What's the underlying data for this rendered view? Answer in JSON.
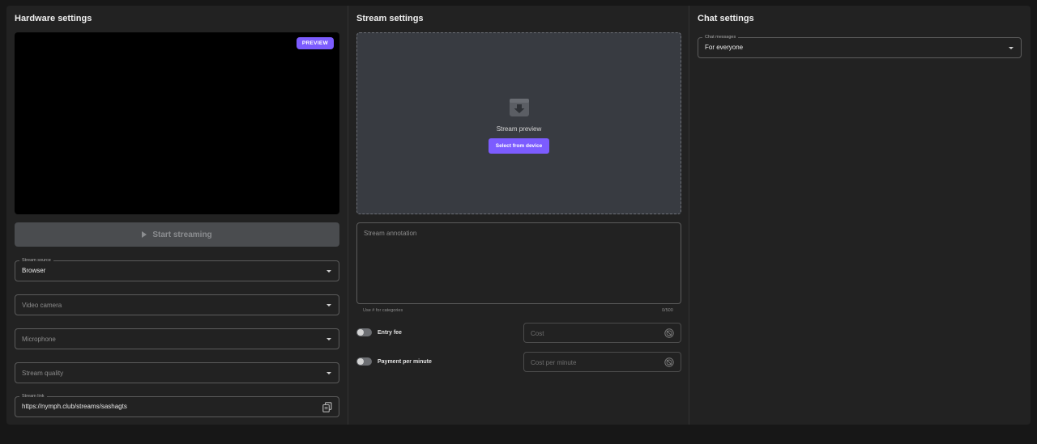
{
  "hardware": {
    "title": "Hardware settings",
    "preview_badge": "PREVIEW",
    "start_button": "Start streaming",
    "stream_source": {
      "label": "Stream source",
      "value": "Browser"
    },
    "video_camera": {
      "placeholder": "Video camera"
    },
    "microphone": {
      "placeholder": "Microphone"
    },
    "stream_quality": {
      "placeholder": "Stream quality"
    },
    "stream_link": {
      "label": "Stream link",
      "value": "https://nymph.club/streams/sashagts"
    }
  },
  "stream": {
    "title": "Stream settings",
    "preview_label": "Stream preview",
    "select_button": "Select from device",
    "annotation_placeholder": "Stream annotation",
    "annotation_hint": "Use # for categories",
    "annotation_counter": "0/500",
    "entry_fee": {
      "label": "Entry fee",
      "cost_placeholder": "Cost"
    },
    "payment_per_minute": {
      "label": "Payment per minute",
      "cost_placeholder": "Cost per minute"
    }
  },
  "chat": {
    "title": "Chat settings",
    "messages": {
      "label": "Chat messages",
      "value": "For everyone"
    }
  },
  "colors": {
    "accent": "#7c5cff",
    "panel": "#222222",
    "background": "#171717"
  },
  "icons": [
    "play-icon",
    "chevron-down-icon",
    "copy-icon",
    "download-tray-icon",
    "coin-icon"
  ]
}
